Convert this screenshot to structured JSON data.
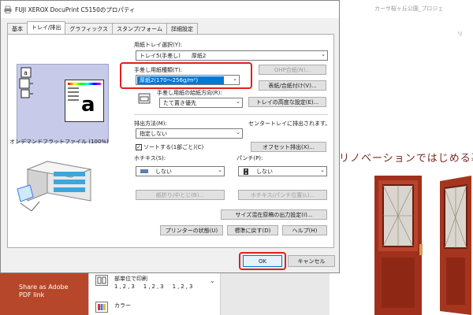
{
  "background": {
    "doc_title": "カーサ桜ヶ丘公園_プロジェ",
    "right_small": "リ",
    "heading": "リノベーションではじめる暮",
    "share_label": "Share as Adobe PDF link",
    "collate_title": "部単位で印刷",
    "collate_sub": "1,2,3　1,2,3　1,2,3",
    "color_label": "カラー"
  },
  "dialog": {
    "title": "FUJI XEROX DocuPrint C5150のプロパティ",
    "tabs": [
      "基本",
      "トレイ/排出",
      "グラフィックス",
      "スタンプ/フォーム",
      "詳細設定"
    ],
    "active_tab": "トレイ/排出",
    "preview_label": "オンデマンドフラットファイル (100%)",
    "tray_select_label": "用紙トレイ選択(Y):",
    "tray_select_value": "トレイ5(手差し)　　厚紙2",
    "ohp_button": "OHP合紙(N)...",
    "manual_paper_type_label": "手差し用紙種類(T):",
    "manual_paper_type_value": "厚紙2(170～256g/m²)",
    "cover_button": "表紙/合紙付け(V)...",
    "manual_direction_label": "手差し用紙の給紙方向(R):",
    "manual_direction_value": "たて置き優先",
    "tray_advanced_button": "トレイの高度な設定(E)...",
    "output_method_label": "排出方法(M):",
    "output_method_value": "指定しない",
    "center_tray_text": "センタートレイに排出されます。",
    "sort_label": "ソートする(1部ごと)(C)",
    "sort_checked": "✓",
    "offset_button": "オフセット排出(X)...",
    "stapler_label": "ホチキス(S):",
    "stapler_value": "しない",
    "punch_label": "パンチ(P):",
    "punch_value": "しない",
    "fold_button": "紙折り/中とじ(B)...",
    "staple_position_button": "ホチキス/パンチ位置(L)...",
    "mixed_size_button": "サイズ混在原稿の出力設定(I)...",
    "printer_status_button": "プリンターの状態(U)",
    "restore_default_button": "標準に戻す(D)",
    "help_button": "ヘルプ(H)",
    "ok_button": "OK",
    "cancel_button": "キャンセル"
  },
  "colors": {
    "highlight": "#0078d7",
    "annotation_red": "#e0201f",
    "preview_bg": "#c7cbe9",
    "share_panel": "#b7472a"
  }
}
